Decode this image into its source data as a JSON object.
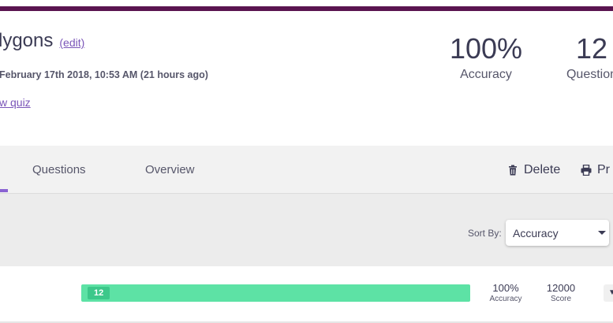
{
  "header": {
    "title": "lygons",
    "edit_label": "(edit)",
    "date_text": "February 17th 2018, 10:53 AM (21 hours ago)",
    "view_link": "w quiz"
  },
  "stats": {
    "accuracy_value": "100%",
    "accuracy_label": "Accuracy",
    "questions_value": "12",
    "questions_label": "Question"
  },
  "tabs": {
    "questions_label": "Questions",
    "overview_label": "Overview"
  },
  "actions": {
    "delete_label": "Delete",
    "print_label": "Pr"
  },
  "sort": {
    "label": "Sort By:",
    "selected": "Accuracy"
  },
  "result_row": {
    "badge": "12",
    "accuracy_value": "100%",
    "accuracy_label": "Accuracy",
    "score_value": "12000",
    "score_label": "Score",
    "progress": 1.0
  },
  "colors": {
    "brand_stripe": "#5a1450",
    "link": "#7a55b8",
    "progress_fill": "#5de2a5",
    "tab_indicator": "#8a63d2"
  },
  "icons": {
    "delete": "trash-icon",
    "print": "printer-icon",
    "sort_caret": "caret-down-icon"
  }
}
